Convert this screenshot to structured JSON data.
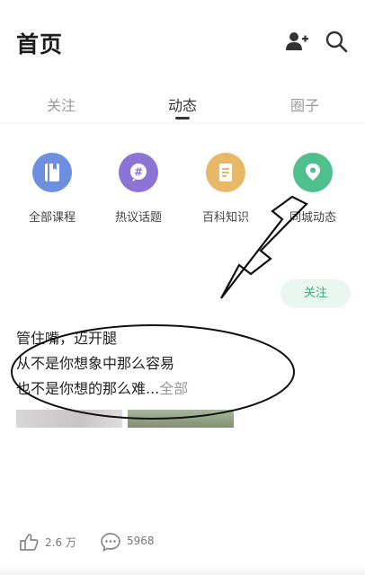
{
  "header": {
    "title": "首页",
    "add_user_icon": "add-user-icon",
    "search_icon": "search-icon"
  },
  "tabs": [
    {
      "label": "关注",
      "active": false
    },
    {
      "label": "动态",
      "active": true
    },
    {
      "label": "圈子",
      "active": false
    }
  ],
  "categories": [
    {
      "label": "全部课程",
      "icon": "book-icon",
      "color": "#6d8fe0"
    },
    {
      "label": "热议话题",
      "icon": "hashtag-bubble-icon",
      "color": "#8c73d6"
    },
    {
      "label": "百科知识",
      "icon": "document-icon",
      "color": "#e8b869"
    },
    {
      "label": "同城动态",
      "icon": "location-pin-icon",
      "color": "#4fc08d"
    }
  ],
  "post": {
    "follow_label": "关注",
    "lines": [
      "管住嘴，迈开腿",
      "从不是你想象中那么容易",
      "也不是你想的那么难..."
    ],
    "more_label": "全部",
    "likes": "2.6 万",
    "comments": "5968"
  },
  "colors": {
    "accent": "#2bb07a",
    "follow_bg": "#eaf7f0"
  }
}
